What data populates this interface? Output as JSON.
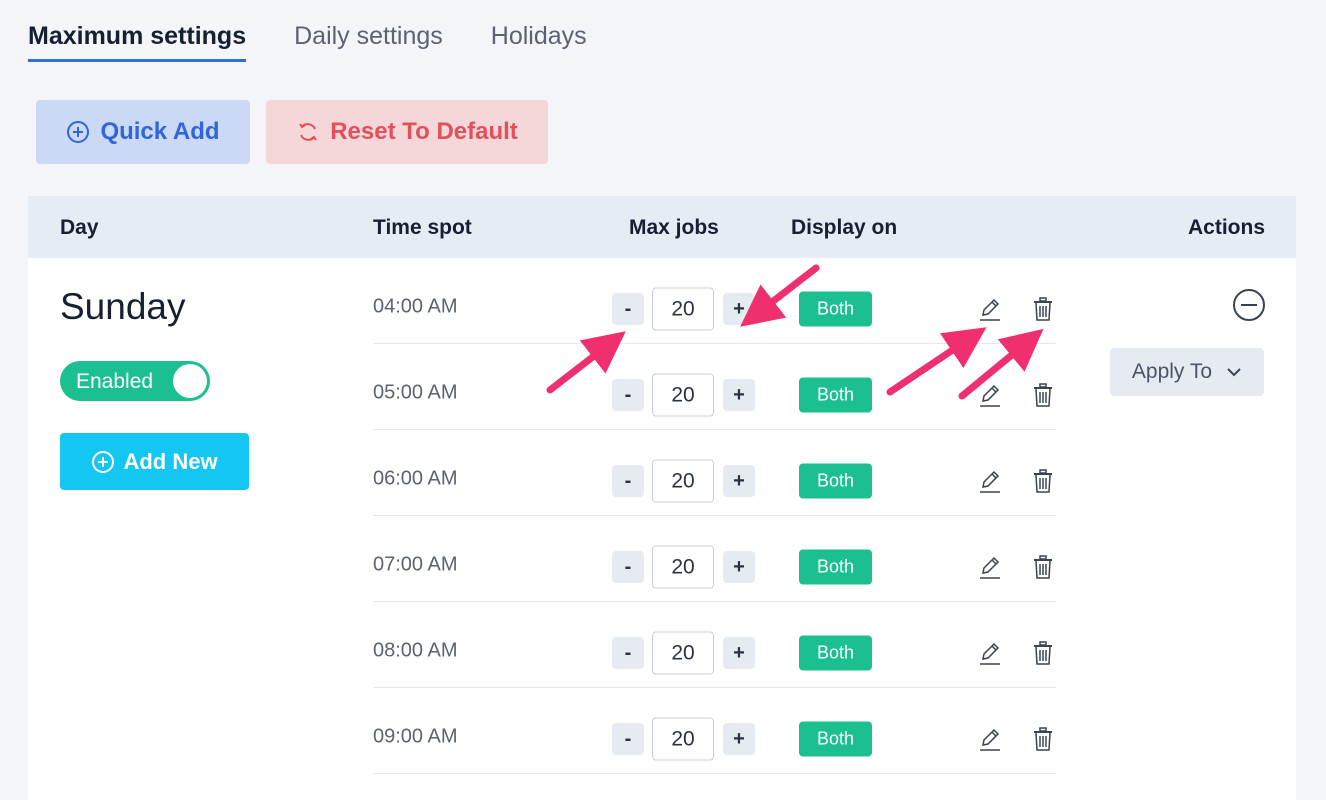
{
  "tabs": [
    {
      "label": "Maximum settings",
      "active": true
    },
    {
      "label": "Daily settings",
      "active": false
    },
    {
      "label": "Holidays",
      "active": false
    }
  ],
  "toolbar": {
    "quick_add_label": "Quick Add",
    "reset_label": "Reset To Default"
  },
  "table": {
    "headers": {
      "day": "Day",
      "time_spot": "Time spot",
      "max_jobs": "Max jobs",
      "display_on": "Display on",
      "actions": "Actions"
    },
    "day": {
      "name": "Sunday",
      "toggle_label": "Enabled",
      "toggle_on": true,
      "add_new_label": "Add New",
      "apply_to_label": "Apply To"
    },
    "rows": [
      {
        "time": "04:00 AM",
        "max_jobs": "20",
        "display_on": "Both",
        "minus": "-",
        "plus": "+"
      },
      {
        "time": "05:00 AM",
        "max_jobs": "20",
        "display_on": "Both",
        "minus": "-",
        "plus": "+"
      },
      {
        "time": "06:00 AM",
        "max_jobs": "20",
        "display_on": "Both",
        "minus": "-",
        "plus": "+"
      },
      {
        "time": "07:00 AM",
        "max_jobs": "20",
        "display_on": "Both",
        "minus": "-",
        "plus": "+"
      },
      {
        "time": "08:00 AM",
        "max_jobs": "20",
        "display_on": "Both",
        "minus": "-",
        "plus": "+"
      },
      {
        "time": "09:00 AM",
        "max_jobs": "20",
        "display_on": "Both",
        "minus": "-",
        "plus": "+"
      }
    ]
  },
  "icons": {
    "quick_add": "plus-circle-icon",
    "reset": "refresh-icon",
    "add_new": "plus-circle-icon",
    "edit": "pencil-icon",
    "delete": "trash-icon",
    "collapse": "minus-circle-icon",
    "apply_dropdown": "chevron-down-icon",
    "annotation": "arrow-icon"
  },
  "colors": {
    "accent_blue": "#2f66d8",
    "reset_red": "#e2505b",
    "enabled_green": "#1cbf8f",
    "add_new_cyan": "#13c7f2",
    "annotation_pink": "#f0306e"
  }
}
